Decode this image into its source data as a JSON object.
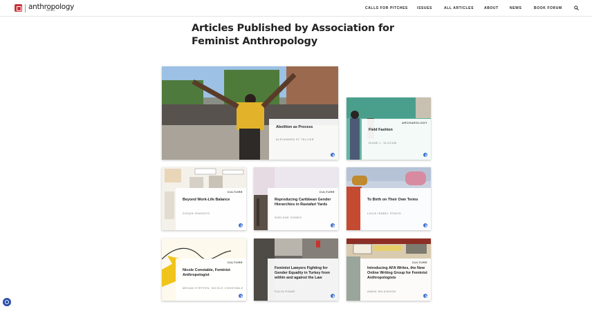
{
  "header": {
    "logo_text": "anthropology",
    "logo_sub": "NEWS",
    "nav": [
      "CALLS FOR PITCHES",
      "ISSUES",
      "ALL ARTICLES",
      "ABOUT",
      "NEWS",
      "BOOK FORUM"
    ]
  },
  "page": {
    "title": "Articles Published by Association for Feminist Anthropology"
  },
  "articles": [
    {
      "category": "",
      "title": "Abolition as Process",
      "author": "ALEXANDRA ST TELLIER"
    },
    {
      "category": "ARCHAEOLOGY",
      "title": "Field Fashion",
      "author": "DIANE L. SLOCUM"
    },
    {
      "category": "CULTURE",
      "title": "Beyond Work-Life Balance",
      "author": "ZHIQIN SHAGUTO"
    },
    {
      "category": "CULTURE",
      "title": "Reproducing Caribbean Gender Hierarchies in Rastafari Yards",
      "author": "SHELENE GOMES"
    },
    {
      "category": "CULTURE",
      "title": "To Birth on Their Own Terms",
      "author": "LUCIA ISABEL STAVIG"
    },
    {
      "category": "CULTURE",
      "title": "Nicole Constable, Feminist Anthropologist",
      "author": "MEGAN STEFFEN, NICOLE CONSTABLE"
    },
    {
      "category": "CULTURE",
      "title": "Feminist Lawyers Fighting for Gender Equality in Turkey from within and against the Law",
      "author": "FULYA PINAR"
    },
    {
      "category": "CULTURE",
      "title": "Introducing AFA Writes, the New Online Writing Group for Feminist Anthropologists",
      "author": "ANNIE WILKINSON"
    }
  ],
  "colors": {
    "accent": "#3a6fd1",
    "brand": "#c8323c"
  }
}
